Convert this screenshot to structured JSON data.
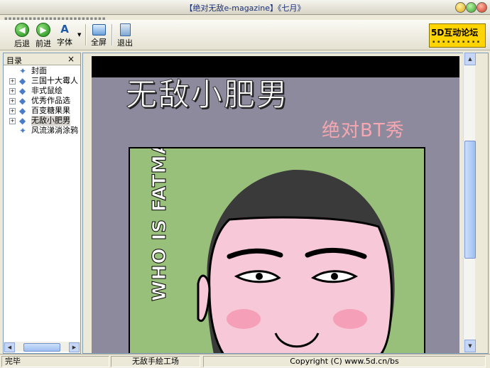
{
  "window": {
    "title": "【绝对无敌e-magazine】《七月》"
  },
  "toolbar": {
    "buttons": [
      {
        "label": "后退",
        "icon": "back-arrow-icon"
      },
      {
        "label": "前进",
        "icon": "forward-arrow-icon"
      },
      {
        "label": "字体",
        "icon": "font-icon"
      },
      {
        "label": "全屏",
        "icon": "fullscreen-icon"
      },
      {
        "label": "退出",
        "icon": "exit-icon"
      }
    ],
    "logo_text": "5D互动论坛"
  },
  "sidebar": {
    "title": "目录",
    "close_glyph": "×",
    "items": [
      {
        "label": "封面",
        "expandable": false
      },
      {
        "label": "三国十大霉人",
        "expandable": true
      },
      {
        "label": "非式鼠绘",
        "expandable": true
      },
      {
        "label": "优秀作品选",
        "expandable": true
      },
      {
        "label": "百变糖果果",
        "expandable": true
      },
      {
        "label": "无敌小肥男",
        "expandable": true,
        "selected": true
      },
      {
        "label": "风流涕淌涂鸦",
        "expandable": false
      }
    ]
  },
  "content": {
    "title": "无敌小肥男",
    "subtitle": "绝对BT秀",
    "vertical_text": "WHO IS FATMAN"
  },
  "statusbar": {
    "status": "完毕",
    "section": "无敌手絵工场",
    "copyright": "Copyright (C) www.5d.cn/bs"
  },
  "colors": {
    "page_bg": "#8E8A9E",
    "art_bg": "#99C07A",
    "subtitle": "#F4A7B0",
    "logo": "#FFD400"
  }
}
